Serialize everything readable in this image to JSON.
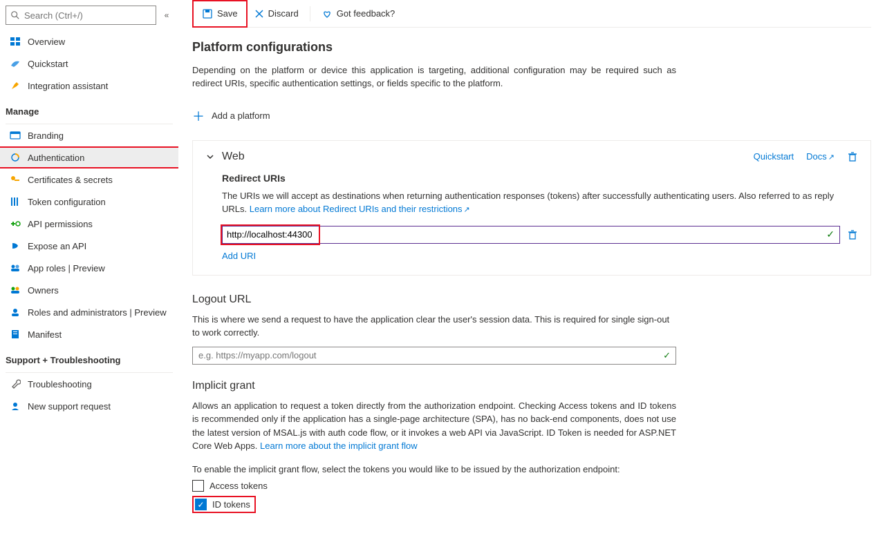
{
  "search": {
    "placeholder": "Search (Ctrl+/)"
  },
  "sidebar": {
    "items_top": [
      {
        "label": "Overview",
        "icon": "overview"
      },
      {
        "label": "Quickstart",
        "icon": "quickstart"
      },
      {
        "label": "Integration assistant",
        "icon": "rocket"
      }
    ],
    "manage_label": "Manage",
    "items_manage": [
      {
        "label": "Branding",
        "icon": "branding"
      },
      {
        "label": "Authentication",
        "icon": "auth",
        "active": true
      },
      {
        "label": "Certificates & secrets",
        "icon": "key"
      },
      {
        "label": "Token configuration",
        "icon": "token"
      },
      {
        "label": "API permissions",
        "icon": "api"
      },
      {
        "label": "Expose an API",
        "icon": "expose"
      },
      {
        "label": "App roles | Preview",
        "icon": "roles"
      },
      {
        "label": "Owners",
        "icon": "owners"
      },
      {
        "label": "Roles and administrators | Preview",
        "icon": "admins"
      },
      {
        "label": "Manifest",
        "icon": "manifest"
      }
    ],
    "support_label": "Support + Troubleshooting",
    "items_support": [
      {
        "label": "Troubleshooting",
        "icon": "wrench"
      },
      {
        "label": "New support request",
        "icon": "support"
      }
    ]
  },
  "toolbar": {
    "save": "Save",
    "discard": "Discard",
    "feedback": "Got feedback?"
  },
  "page": {
    "title": "Platform configurations",
    "intro": "Depending on the platform or device this application is targeting, additional configuration may be required such as redirect URIs, specific authentication settings, or fields specific to the platform.",
    "add_platform": "Add a platform"
  },
  "web": {
    "title": "Web",
    "quickstart": "Quickstart",
    "docs": "Docs",
    "redirect_title": "Redirect URIs",
    "redirect_desc_a": "The URIs we will accept as destinations when returning authentication responses (tokens) after successfully authenticating users. Also referred to as reply URLs. ",
    "redirect_desc_link": "Learn more about Redirect URIs and their restrictions",
    "uri_value": "http://localhost:44300",
    "add_uri": "Add URI"
  },
  "logout": {
    "title": "Logout URL",
    "desc": "This is where we send a request to have the application clear the user's session data. This is required for single sign-out to work correctly.",
    "placeholder": "e.g. https://myapp.com/logout"
  },
  "implicit": {
    "title": "Implicit grant",
    "desc_a": "Allows an application to request a token directly from the authorization endpoint. Checking Access tokens and ID tokens is recommended only if the application has a single-page architecture (SPA), has no back-end components, does not use the latest version of MSAL.js with auth code flow, or it invokes a web API via JavaScript. ID Token is needed for ASP.NET Core Web Apps. ",
    "desc_link": "Learn more about the implicit grant flow",
    "enable_text": "To enable the implicit grant flow, select the tokens you would like to be issued by the authorization endpoint:",
    "access_tokens": "Access tokens",
    "id_tokens": "ID tokens"
  }
}
